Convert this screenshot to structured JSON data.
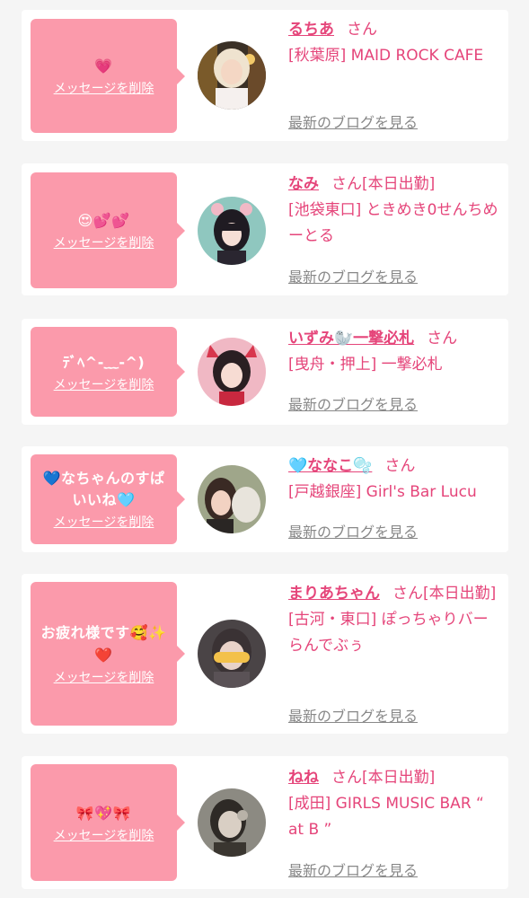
{
  "messages": [
    {
      "message": "💗",
      "delete_label": "メッセージを削除",
      "name": "るちあ",
      "suffix": "さん",
      "shop": "[秋葉原] MAID ROCK CAFE",
      "blog_label": "最新のブログを見る"
    },
    {
      "message": "😍💕💕",
      "delete_label": "メッセージを削除",
      "name": "なみ",
      "suffix": "さん[本日出勤]",
      "shop": "[池袋東口] ときめき0せんちめーとる",
      "blog_label": "最新のブログを見る"
    },
    {
      "message": "ﾃﾞﾍ^-﹏-^)",
      "delete_label": "メッセージを削除",
      "name": "いずみ🦭一撃必札",
      "suffix": "さん",
      "shop": "[曳舟・押上] 一撃必札",
      "blog_label": "最新のブログを見る"
    },
    {
      "message": "💙なちゃんのすぱいいね🩵",
      "delete_label": "メッセージを削除",
      "name": "🩵ななこ🫧",
      "suffix": "さん",
      "shop": "[戸越銀座] Girl's Bar Lucu",
      "blog_label": "最新のブログを見る"
    },
    {
      "message": "お疲れ様です🥰✨❤️",
      "delete_label": "メッセージを削除",
      "name": "まりあちゃん",
      "suffix": "さん[本日出勤]",
      "shop": "[古河・東口] ぽっちゃりバー らんでぶぅ",
      "blog_label": "最新のブログを見る"
    },
    {
      "message": "🎀💖🎀",
      "delete_label": "メッセージを削除",
      "name": "ねね",
      "suffix": "さん[本日出勤]",
      "shop": "[成田] GIRLS MUSIC BAR “ at B ”",
      "blog_label": "最新のブログを見る"
    }
  ],
  "colors": {
    "bubble": "#fb9aab",
    "accent": "#e5457a",
    "muted": "#888888",
    "background": "#f5f5f5"
  }
}
